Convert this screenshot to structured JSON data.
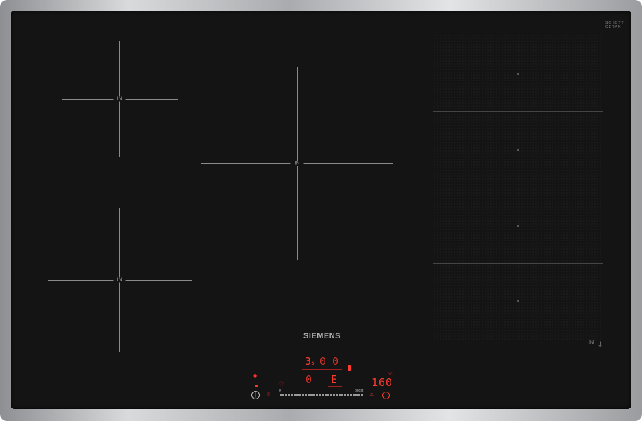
{
  "brand": "SIEMENS",
  "glass_logo": "SCHOTT CERAN",
  "zones": {
    "label": "IN"
  },
  "flex_zone": {
    "label": "IN",
    "segments": 4
  },
  "controls": {
    "zone_display_1": "3",
    "zone_display_1_sub": "s",
    "zone_display_2": "0",
    "zone_display_3": "0",
    "zone_display_4": "0",
    "zone_display_5": "E",
    "slider_min": "0",
    "slider_max": "boost",
    "temperature": "160",
    "temperature_unit": "°C"
  },
  "colors": {
    "display": "#ff3b30",
    "glass": "#141414"
  }
}
